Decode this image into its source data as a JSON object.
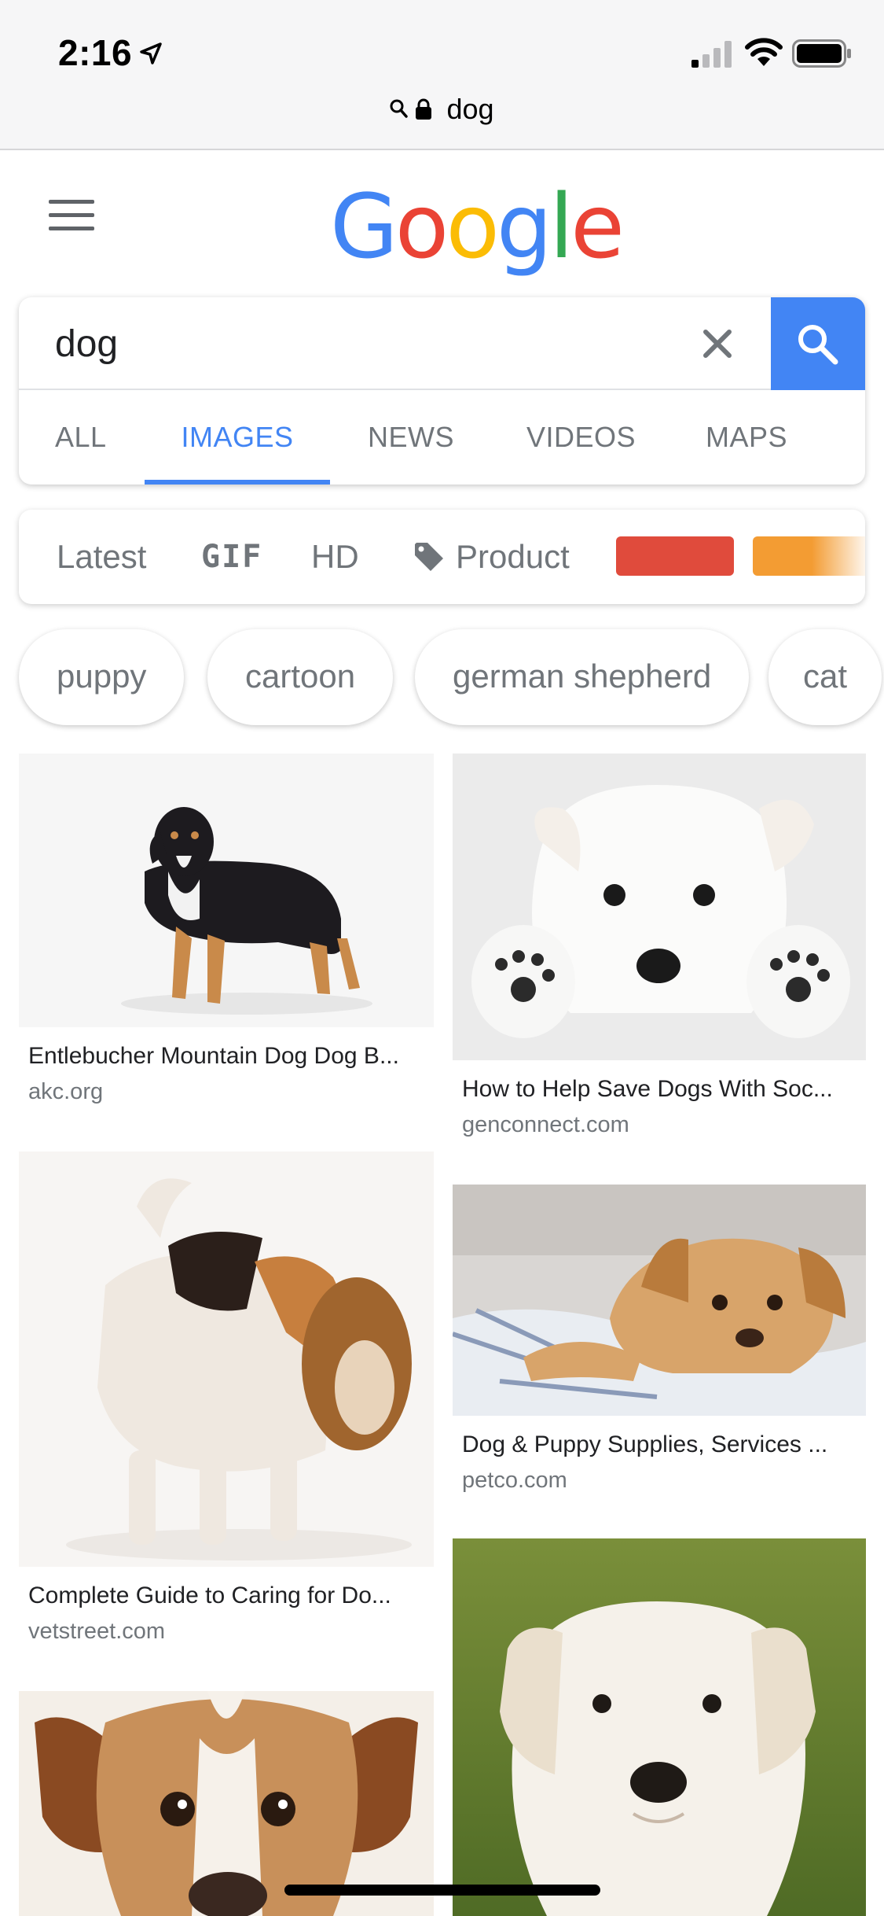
{
  "status_bar": {
    "time": "2:16"
  },
  "url_bar": {
    "text": "dog"
  },
  "logo": {
    "letters": [
      "G",
      "o",
      "o",
      "g",
      "l",
      "e"
    ]
  },
  "search": {
    "query": "dog"
  },
  "tabs": [
    {
      "label": "ALL"
    },
    {
      "label": "IMAGES"
    },
    {
      "label": "NEWS"
    },
    {
      "label": "VIDEOS"
    },
    {
      "label": "MAPS"
    }
  ],
  "filters": {
    "latest": "Latest",
    "gif": "GIF",
    "hd": "HD",
    "product": "Product",
    "colors": [
      "#e04b3c",
      "#f39c33"
    ]
  },
  "suggestions": [
    {
      "label": "puppy"
    },
    {
      "label": "cartoon"
    },
    {
      "label": "german shepherd"
    },
    {
      "label": "cat"
    }
  ],
  "results": [
    {
      "title": "Entlebucher Mountain Dog Dog B...",
      "domain": "akc.org"
    },
    {
      "title": "How to Help Save Dogs With Soc...",
      "domain": "genconnect.com"
    },
    {
      "title": "Complete Guide to Caring for Do...",
      "domain": "vetstreet.com"
    },
    {
      "title": "Dog & Puppy Supplies, Services ...",
      "domain": "petco.com"
    }
  ],
  "colors": {
    "accent": "#4285f4",
    "google_blue": "#4285f4",
    "google_red": "#ea4335",
    "google_yellow": "#fbbc05",
    "google_green": "#34a853"
  }
}
